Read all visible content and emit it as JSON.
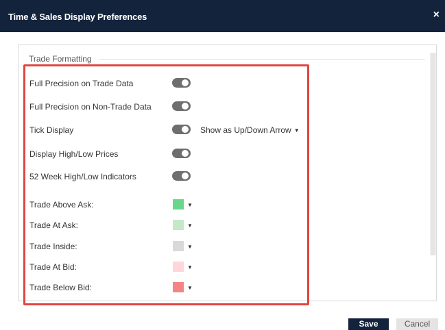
{
  "dialog": {
    "title": "Time & Sales Display Preferences",
    "close_glyph": "×"
  },
  "section": {
    "legend": "Trade Formatting"
  },
  "toggles": [
    {
      "label": "Full Precision on Trade Data",
      "on": true
    },
    {
      "label": "Full Precision on Non-Trade Data",
      "on": true
    },
    {
      "label": "Tick Display",
      "on": true
    },
    {
      "label": "Display High/Low Prices",
      "on": true
    },
    {
      "label": "52 Week High/Low Indicators",
      "on": true
    }
  ],
  "tick_display": {
    "selected": "Show as Up/Down Arrow",
    "caret": "▼"
  },
  "colors": [
    {
      "label": "Trade Above Ask:",
      "color": "#6ad68a"
    },
    {
      "label": "Trade At Ask:",
      "color": "#c5e8c9"
    },
    {
      "label": "Trade Inside:",
      "color": "#d9d9d9"
    },
    {
      "label": "Trade At Bid:",
      "color": "#ffd6d9"
    },
    {
      "label": "Trade Below Bid:",
      "color": "#f48484"
    }
  ],
  "color_caret": "▼",
  "highlight_color": "#e0453f",
  "footer": {
    "save_label": "Save",
    "cancel_label": "Cancel"
  }
}
